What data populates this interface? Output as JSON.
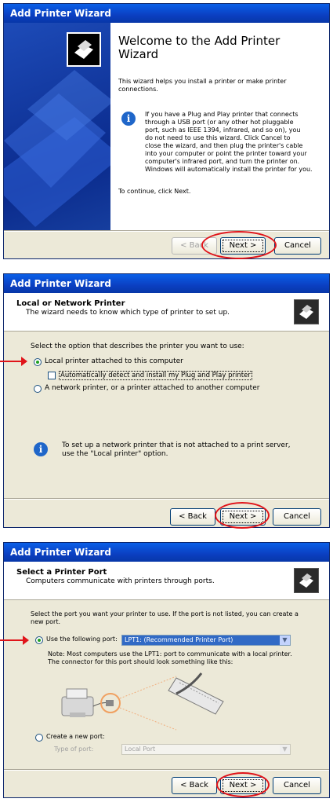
{
  "window1": {
    "title": "Add Printer Wizard",
    "heading_line1": "Welcome to the Add Printer",
    "heading_line2": "Wizard",
    "intro_line1": "This wizard helps you install a printer or make printer",
    "intro_line2": "connections.",
    "info_lines": [
      "If you have a Plug and Play printer that connects",
      "through a USB port (or any other hot pluggable",
      "port, such as IEEE 1394, infrared, and so on), you",
      "do not need to use this wizard. Click Cancel to",
      "close the wizard, and then plug the printer's cable",
      "into your computer or point the printer toward your",
      "computer's infrared port, and turn the printer on.",
      "Windows will automatically install the printer for you."
    ],
    "continue_text": "To continue, click Next.",
    "back_label": "< Back",
    "next_label": "Next >",
    "cancel_label": "Cancel"
  },
  "window2": {
    "title": "Add Printer Wizard",
    "header_title": "Local or Network Printer",
    "header_subtitle": "The wizard needs to know which type of printer to set up.",
    "prompt": "Select the option that describes the printer you want to use:",
    "option_local": "Local printer attached to this computer",
    "option_autodetect": "Automatically detect and install my Plug and Play printer",
    "option_network": "A network printer, or a printer attached to another computer",
    "info_line1": "To set up a network printer that is not attached to a print server,",
    "info_line2": "use the \"Local printer\" option.",
    "back_label": "< Back",
    "next_label": "Next >",
    "cancel_label": "Cancel"
  },
  "window3": {
    "title": "Add Printer Wizard",
    "header_title": "Select a Printer Port",
    "header_subtitle": "Computers communicate with printers through ports.",
    "prompt_line1": "Select the port you want your printer to use.  If the port is not listed, you can create a",
    "prompt_line2": "new port.",
    "use_port_label": "Use the following port:",
    "port_value": "LPT1: (Recommended Printer Port)",
    "note_line1": "Note: Most computers use the LPT1: port to communicate with a local printer.",
    "note_line2": "The connector for this port should look something like this:",
    "create_port_label": "Create a new port:",
    "type_of_port_label": "Type of port:",
    "type_of_port_value": "Local Port",
    "back_label": "< Back",
    "next_label": "Next >",
    "cancel_label": "Cancel"
  },
  "colors": {
    "titlebar": "#0b3fc1",
    "highlight_red": "#e0141a",
    "dialog_bg": "#ece9d8",
    "info_blue": "#1f66c9"
  }
}
